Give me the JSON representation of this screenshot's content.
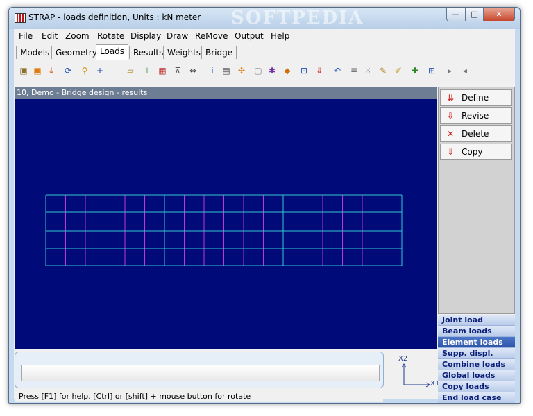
{
  "window": {
    "title": "STRAP - loads definition, Units : kN meter",
    "watermark": "SOFTPEDIA",
    "minimize_label": "—",
    "maximize_label": "□",
    "close_label": "✕"
  },
  "menu": [
    "File",
    "Edit",
    "Zoom",
    "Rotate",
    "Display",
    "Draw",
    "ReMove",
    "Output",
    "Help"
  ],
  "tabs": [
    {
      "label": "Models",
      "active": false
    },
    {
      "label": "Geometry",
      "active": false
    },
    {
      "label": "Loads",
      "active": true
    },
    {
      "label": "Results",
      "active": false
    },
    {
      "label": "Weights",
      "active": false
    },
    {
      "label": "Bridge",
      "active": false
    }
  ],
  "toolbar": {
    "icons": [
      {
        "name": "cube-view-icon",
        "glyph": "▣",
        "color": "#8b6f2e"
      },
      {
        "name": "box-select-icon",
        "glyph": "▣",
        "color": "#e07b10"
      },
      {
        "name": "arrow-down-icon",
        "glyph": "↓",
        "color": "#e06010"
      },
      {
        "name": "rotate-icon",
        "glyph": "⟳",
        "color": "#1f4fb0"
      },
      {
        "name": "zoom-icon",
        "glyph": "⚲",
        "color": "#d08a00"
      },
      {
        "name": "number-joint-icon",
        "glyph": "+",
        "color": "#1f4fb0"
      },
      {
        "name": "number-beam-icon",
        "glyph": "―",
        "color": "#e07b10"
      },
      {
        "name": "number-element-icon",
        "glyph": "▱",
        "color": "#b08020"
      },
      {
        "name": "number-support-icon",
        "glyph": "⊥",
        "color": "#2a8a2a"
      },
      {
        "name": "color-scale-icon",
        "glyph": "▦",
        "color": "#c03030"
      },
      {
        "name": "support-icon",
        "glyph": "⊼",
        "color": "#555555"
      },
      {
        "name": "dimension-icon",
        "glyph": "⇔",
        "color": "#444444"
      },
      {
        "name": "info-icon",
        "glyph": "i",
        "color": "#1f5fd0"
      },
      {
        "name": "grid-icon",
        "glyph": "▤",
        "color": "#444444"
      },
      {
        "name": "axes-icon",
        "glyph": "✣",
        "color": "#e07b10"
      },
      {
        "name": "frame-icon",
        "glyph": "▢",
        "color": "#888888"
      },
      {
        "name": "mesh-icon",
        "glyph": "✱",
        "color": "#7030a0"
      },
      {
        "name": "cube-icon",
        "glyph": "◆",
        "color": "#d07010"
      },
      {
        "name": "xy-plane-icon",
        "glyph": "⊡",
        "color": "#1f4fb0"
      },
      {
        "name": "load-arrow-icon",
        "glyph": "⇓",
        "color": "#d02020"
      },
      {
        "name": "undo-icon",
        "glyph": "↶",
        "color": "#1f4fb0"
      },
      {
        "name": "stack-icon",
        "glyph": "≣",
        "color": "#666666"
      },
      {
        "name": "select-icon",
        "glyph": "⁙",
        "color": "#888888"
      },
      {
        "name": "pen-icon",
        "glyph": "✎",
        "color": "#b08020"
      },
      {
        "name": "eraser-icon",
        "glyph": "✐",
        "color": "#c0a030"
      },
      {
        "name": "add-element-icon",
        "glyph": "✚",
        "color": "#2a8a2a"
      },
      {
        "name": "zoom-window-icon",
        "glyph": "⊞",
        "color": "#1f4fb0"
      },
      {
        "name": "next-icon",
        "glyph": "▸",
        "color": "#777777"
      },
      {
        "name": "previous-icon",
        "glyph": "◂",
        "color": "#777777"
      }
    ]
  },
  "viewport": {
    "title": "10, Demo - Bridge design - results",
    "background": "#000a78",
    "grid_color": "#34c8d2",
    "beam_color": "#c435d2"
  },
  "panel": {
    "buttons": [
      {
        "name": "define-button",
        "label": "Define",
        "icon": "define-icon",
        "glyph": "⇊",
        "color": "#d02020"
      },
      {
        "name": "revise-button",
        "label": "Revise",
        "icon": "revise-icon",
        "glyph": "⇩",
        "color": "#d02020"
      },
      {
        "name": "delete-button",
        "label": "Delete",
        "icon": "delete-icon",
        "glyph": "✕",
        "color": "#d01010"
      },
      {
        "name": "copy-button",
        "label": "Copy",
        "icon": "copy-icon",
        "glyph": "⇓",
        "color": "#d02020"
      }
    ]
  },
  "load_list": [
    {
      "label": "Joint load",
      "active": false
    },
    {
      "label": "Beam loads",
      "active": false
    },
    {
      "label": "Element loads",
      "active": true
    },
    {
      "label": "Supp. displ.",
      "active": false
    },
    {
      "label": "Combine loads",
      "active": false
    },
    {
      "label": "Global loads",
      "active": false
    },
    {
      "label": "Copy loads",
      "active": false
    },
    {
      "label": "End load case",
      "active": false
    }
  ],
  "axes": {
    "x_label": "X1",
    "y_label": "X2"
  },
  "status": {
    "text": "Press [F1] for help. [Ctrl] or [shift] + mouse button for rotate"
  }
}
